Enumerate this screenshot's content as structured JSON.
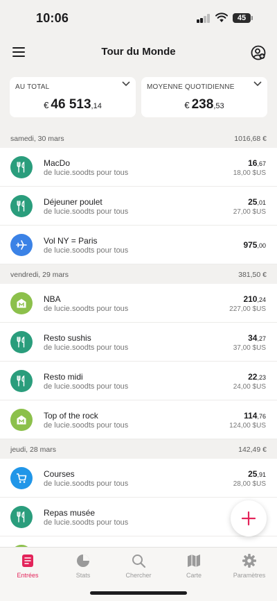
{
  "status": {
    "time": "10:06",
    "battery": "45"
  },
  "header": {
    "title": "Tour du Monde"
  },
  "summary": {
    "total": {
      "label": "AU TOTAL",
      "currency": "€",
      "int": "46 513",
      "dec": ",14"
    },
    "daily": {
      "label": "MOYENNE QUOTIDIENNE",
      "currency": "€",
      "int": "238",
      "dec": ",53"
    }
  },
  "days": [
    {
      "date": "samedi, 30 mars",
      "total": "1016,68 €",
      "entries": [
        {
          "name": "MacDo",
          "sub": "de lucie.soodts pour tous",
          "int": "16",
          "dec": ",67",
          "orig": "18,00 $US",
          "icon": "cutlery-icon",
          "color": "#2a9d7c"
        },
        {
          "name": "Déjeuner poulet",
          "sub": "de lucie.soodts pour tous",
          "int": "25",
          "dec": ",01",
          "orig": "27,00 $US",
          "icon": "cutlery-icon",
          "color": "#2a9d7c"
        },
        {
          "name": "Vol NY = Paris",
          "sub": "de lucie.soodts pour tous",
          "int": "975",
          "dec": ",00",
          "orig": "",
          "icon": "airplane-icon",
          "color": "#3b82e6"
        }
      ]
    },
    {
      "date": "vendredi, 29 mars",
      "total": "381,50 €",
      "entries": [
        {
          "name": "NBA",
          "sub": "de lucie.soodts pour tous",
          "int": "210",
          "dec": ",24",
          "orig": "227,00 $US",
          "icon": "museum-icon",
          "color": "#8cc04b"
        },
        {
          "name": "Resto sushis",
          "sub": "de lucie.soodts pour tous",
          "int": "34",
          "dec": ",27",
          "orig": "37,00 $US",
          "icon": "cutlery-icon",
          "color": "#2a9d7c"
        },
        {
          "name": "Resto midi",
          "sub": "de lucie.soodts pour tous",
          "int": "22",
          "dec": ",23",
          "orig": "24,00 $US",
          "icon": "cutlery-icon",
          "color": "#2a9d7c"
        },
        {
          "name": "Top of the rock",
          "sub": "de lucie.soodts pour tous",
          "int": "114",
          "dec": ",76",
          "orig": "124,00 $US",
          "icon": "museum-icon",
          "color": "#8cc04b"
        }
      ]
    },
    {
      "date": "jeudi, 28 mars",
      "total": "142,49 €",
      "entries": [
        {
          "name": "Courses",
          "sub": "de lucie.soodts pour tous",
          "int": "25",
          "dec": ",91",
          "orig": "28,00 $US",
          "icon": "cart-icon",
          "color": "#2196e8"
        },
        {
          "name": "Repas musée",
          "sub": "de lucie.soodts pour tous",
          "int": "",
          "dec": "",
          "orig": "",
          "icon": "cutlery-icon",
          "color": "#2a9d7c"
        }
      ]
    }
  ],
  "tabs": [
    {
      "label": "Entrées",
      "icon": "entries-icon"
    },
    {
      "label": "Stats",
      "icon": "pie-chart-icon"
    },
    {
      "label": "Chercher",
      "icon": "search-icon"
    },
    {
      "label": "Carte",
      "icon": "map-icon"
    },
    {
      "label": "Paramètres",
      "icon": "gear-icon"
    }
  ],
  "colors": {
    "accent": "#e3245a",
    "background": "#f2f1ef"
  }
}
